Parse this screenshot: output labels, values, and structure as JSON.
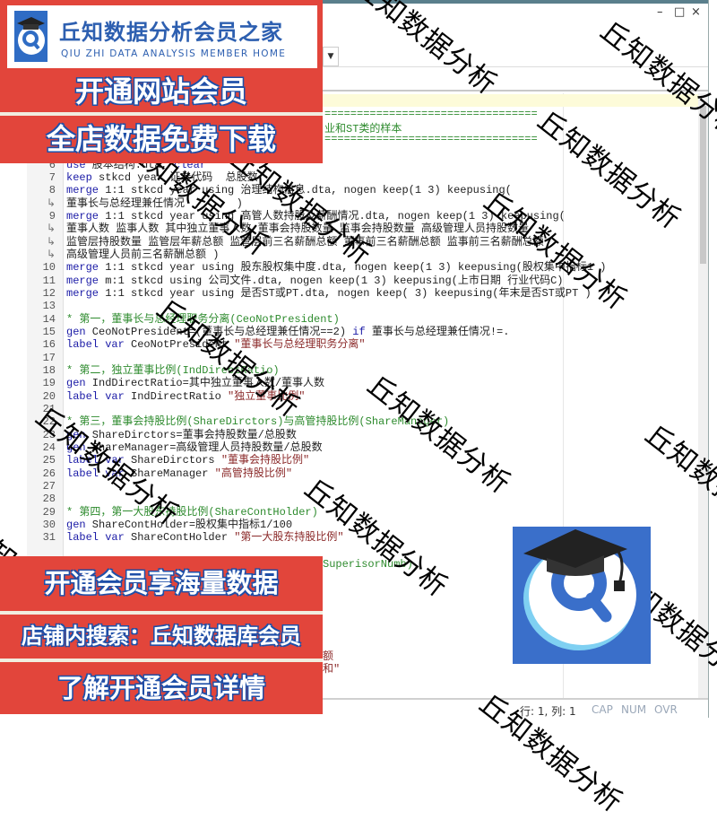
{
  "window": {
    "controls": {
      "minimize": "–",
      "maximize": "□",
      "close": "×"
    },
    "toolbar_dropdown_arrow": "▼"
  },
  "editor": {
    "fragments": {
      "line2": "=================================",
      "line3": "业和ST类的样本",
      "line4": "=================================",
      "line33": "SuperisorNumb)",
      "line37": "额",
      "line38": "和\""
    },
    "lines": [
      {
        "n": "1",
        "seg": []
      },
      {
        "n": "2",
        "seg": []
      },
      {
        "n": "3",
        "seg": []
      },
      {
        "n": "4",
        "seg": []
      },
      {
        "n": "5",
        "seg": []
      },
      {
        "n": "6",
        "seg": [
          [
            "kw",
            "use"
          ],
          [
            "tx",
            " 股本结构.dta, "
          ],
          [
            "kw",
            "clear"
          ]
        ]
      },
      {
        "n": "7",
        "seg": [
          [
            "kw",
            "keep"
          ],
          [
            "tx",
            " stkcd year 证券代码  总股数"
          ]
        ]
      },
      {
        "n": "8",
        "seg": [
          [
            "kw",
            "merge"
          ],
          [
            "tx",
            " 1:1 stkcd year using 治理结构信息.dta, nogen keep(1 3) keepusing("
          ]
        ]
      },
      {
        "n": "",
        "wrap": true,
        "seg": [
          [
            "tx",
            "董事长与总经理兼任情况        )"
          ]
        ]
      },
      {
        "n": "9",
        "seg": [
          [
            "kw",
            "merge"
          ],
          [
            "tx",
            " 1:1 stkcd year using 高管人数持股及薪酬情况.dta, nogen keep(1 3) keepusing("
          ]
        ]
      },
      {
        "n": "",
        "wrap": true,
        "seg": [
          [
            "tx",
            "董事人数 监事人数 其中独立董事人数 董事会持股数量 监事会持股数量 高级管理人员持股数量"
          ]
        ]
      },
      {
        "n": "",
        "wrap": true,
        "seg": [
          [
            "tx",
            "监管层持股数量 监管层年薪总额 监管层前三名薪酬总额 董事前三名薪酬总额 监事前三名薪酬总额"
          ]
        ]
      },
      {
        "n": "",
        "wrap": true,
        "seg": [
          [
            "tx",
            "高级管理人员前三名薪酬总额 )"
          ]
        ]
      },
      {
        "n": "10",
        "seg": [
          [
            "kw",
            "merge"
          ],
          [
            "tx",
            " 1:1 stkcd year using 股东股权集中度.dta, nogen keep(1 3) keepusing(股权集中指标1 )"
          ]
        ]
      },
      {
        "n": "11",
        "seg": [
          [
            "kw",
            "merge"
          ],
          [
            "tx",
            " m:1 stkcd using 公司文件.dta, nogen keep(1 3) keepusing(上市日期 行业代码C)"
          ]
        ]
      },
      {
        "n": "12",
        "seg": [
          [
            "kw",
            "merge"
          ],
          [
            "tx",
            " 1:1 stkcd year using 是否ST或PT.dta, nogen keep( 3) keepusing(年末是否ST或PT )"
          ]
        ]
      },
      {
        "n": "13",
        "seg": []
      },
      {
        "n": "14",
        "seg": [
          [
            "cm",
            "* 第一，董事长与总经理职务分离(CeoNotPresident)"
          ]
        ]
      },
      {
        "n": "15",
        "seg": [
          [
            "kw",
            "gen"
          ],
          [
            "tx",
            " CeoNotPresident=(董事长与总经理兼任情况==2) "
          ],
          [
            "kw",
            "if"
          ],
          [
            "tx",
            " 董事长与总经理兼任情况!=."
          ]
        ]
      },
      {
        "n": "16",
        "seg": [
          [
            "kw",
            "label var"
          ],
          [
            "tx",
            " CeoNotPresident "
          ],
          [
            "str",
            "\"董事长与总经理职务分离\""
          ]
        ]
      },
      {
        "n": "17",
        "seg": []
      },
      {
        "n": "18",
        "seg": [
          [
            "cm",
            "* 第二，独立董事比例(IndDirectRatio)"
          ]
        ]
      },
      {
        "n": "19",
        "seg": [
          [
            "kw",
            "gen"
          ],
          [
            "tx",
            " IndDirectRatio=其中独立董事人数/董事人数"
          ]
        ]
      },
      {
        "n": "20",
        "seg": [
          [
            "kw",
            "label var"
          ],
          [
            "tx",
            " IndDirectRatio "
          ],
          [
            "str",
            "\"独立董事比例\""
          ]
        ]
      },
      {
        "n": "21",
        "seg": []
      },
      {
        "n": "22",
        "seg": [
          [
            "cm",
            "* 第三，董事会持股比例(ShareDirctors)与高管持股比例(ShareManager)"
          ]
        ]
      },
      {
        "n": "23",
        "seg": [
          [
            "kw",
            "gen"
          ],
          [
            "tx",
            " ShareDirctors=董事会持股数量/总股数"
          ]
        ]
      },
      {
        "n": "24",
        "seg": [
          [
            "kw",
            "gen"
          ],
          [
            "tx",
            " ShareManager=高级管理人员持股数量/总股数"
          ]
        ]
      },
      {
        "n": "25",
        "seg": [
          [
            "kw",
            "label var"
          ],
          [
            "tx",
            " ShareDirctors "
          ],
          [
            "str",
            "\"董事会持股比例\""
          ]
        ]
      },
      {
        "n": "26",
        "seg": [
          [
            "kw",
            "label var"
          ],
          [
            "tx",
            " ShareManager "
          ],
          [
            "str",
            "\"高管持股比例\""
          ]
        ]
      },
      {
        "n": "27",
        "seg": []
      },
      {
        "n": "28",
        "seg": []
      },
      {
        "n": "29",
        "seg": [
          [
            "cm",
            "* 第四，第一大股东持股比例(ShareContHolder)"
          ]
        ]
      },
      {
        "n": "30",
        "seg": [
          [
            "kw",
            "gen"
          ],
          [
            "tx",
            " ShareContHolder=股权集中指标1/100"
          ]
        ]
      },
      {
        "n": "31",
        "seg": [
          [
            "kw",
            "label var"
          ],
          [
            "tx",
            " ShareContHolder "
          ],
          [
            "str",
            "\"第一大股东持股比例\""
          ]
        ]
      }
    ]
  },
  "status_bar": {
    "position": "行: 1, 列: 1",
    "cap": "CAP",
    "num": "NUM",
    "ovr": "OVR"
  },
  "promo": {
    "brand_cn": "丘知数据分析会员之家",
    "brand_en": "QIU ZHI DATA ANALYSIS MEMBER HOME",
    "banner_top_1": "开通网站会员",
    "banner_top_2": "全店数据免费下载",
    "banner_bottom_1": "开通会员享海量数据",
    "banner_bottom_2": "店铺内搜索：丘知数据库会员",
    "banner_bottom_3": "了解开通会员详情",
    "watermark_text": "丘知数据分析",
    "colors": {
      "red": "#e2453b",
      "blue": "#2d5fb0",
      "text_outline": "#1e4fa8"
    }
  }
}
